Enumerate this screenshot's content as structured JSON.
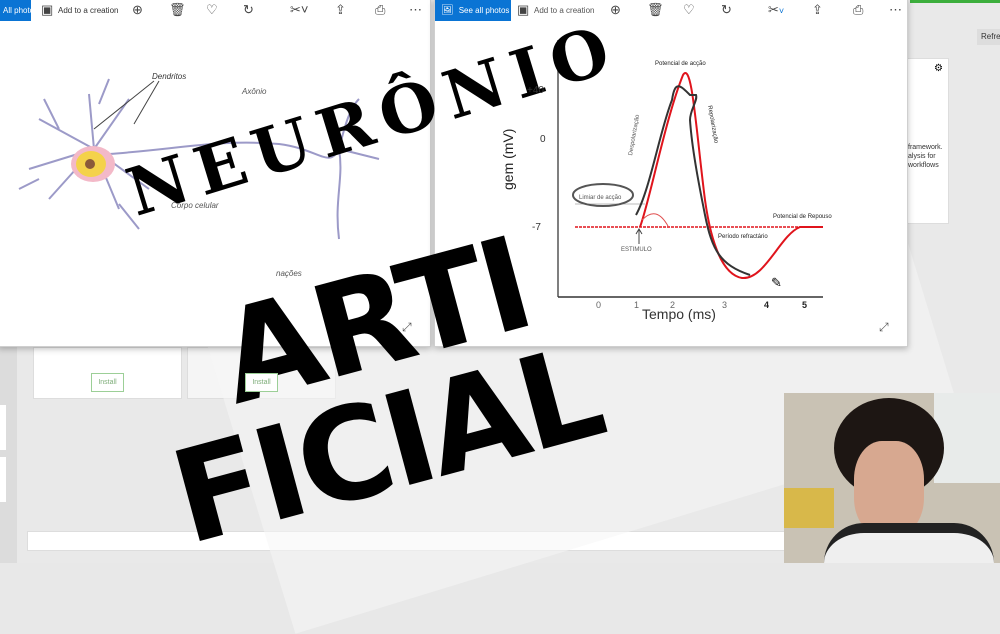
{
  "left_window": {
    "see_all": "All photos",
    "add_to_creation": "Add to a creation",
    "labels": {
      "dendritos": "Dendritos",
      "axonio": "Axônio",
      "corpo": "Corpo celular",
      "terminacoes": "nações"
    }
  },
  "right_window": {
    "see_all": "See all photos",
    "add_to_creation": "Add to a creation",
    "chart": {
      "ylabel": "gem (mV)",
      "xlabel": "Tempo (ms)",
      "yticks": [
        "+40",
        "0",
        "-7"
      ],
      "xticks": [
        "0",
        "1",
        "2",
        "3",
        "4",
        "5"
      ],
      "annotations": {
        "peak": "Potencial de acção",
        "depol": "Despolarização",
        "repol": "Repolarização",
        "limiar": "Limiar de acção",
        "estimulo": "ESTIMULO",
        "repouso": "Potencial de Repouso",
        "refractario": "Período refractário"
      }
    }
  },
  "background_app": {
    "refresh": "Refre",
    "desc": [
      "framework.",
      "alysis for",
      "workflows"
    ],
    "install": [
      "Install",
      "Install"
    ]
  },
  "overlay": {
    "line1": "NEURÔNIO",
    "line2": "ARTI",
    "line3": "FICIAL"
  },
  "colors": {
    "accent": "#0a74d4",
    "red": "#e0141c"
  }
}
